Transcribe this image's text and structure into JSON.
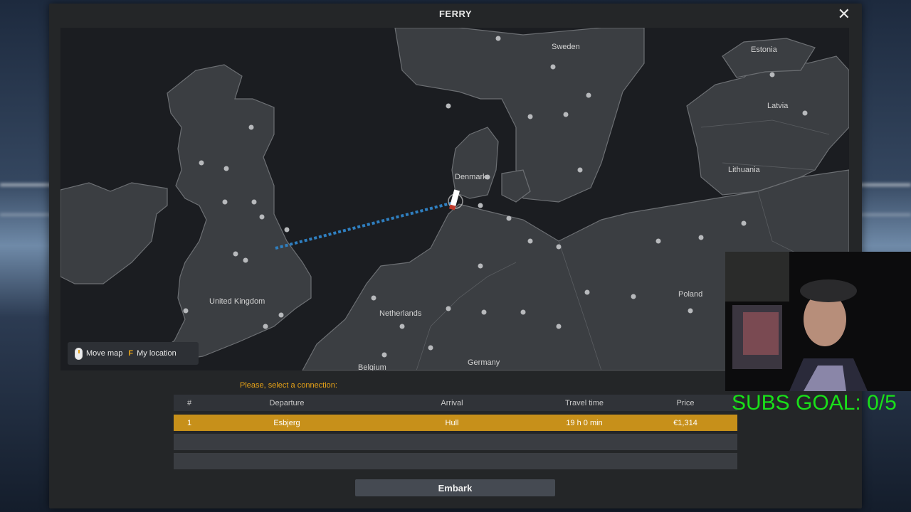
{
  "dialog": {
    "title": "FERRY",
    "close_icon": "close-icon"
  },
  "map": {
    "labels": {
      "sweden": "Sweden",
      "estonia": "Estonia",
      "latvia": "Latvia",
      "lithuania": "Lithuania",
      "denmark": "Denmark",
      "united_kingdom": "United Kingdom",
      "netherlands": "Netherlands",
      "poland": "Poland",
      "germany": "Germany",
      "belgium": "Belgium"
    },
    "route_color": "#2f7fc0"
  },
  "legend": {
    "move_map_icon": "mouse-icon",
    "move_map": "Move map",
    "my_location_key": "F",
    "my_location": "My location"
  },
  "prompt": "Please, select a connection:",
  "table": {
    "headers": {
      "num": "#",
      "departure": "Departure",
      "arrival": "Arrival",
      "travel_time": "Travel time",
      "price": "Price"
    },
    "rows": [
      {
        "num": "1",
        "departure": "Esbjerg",
        "arrival": "Hull",
        "travel_time": "19 h 0 min",
        "price": "€1,314"
      }
    ]
  },
  "embark_label": "Embark",
  "overlay": {
    "subs_goal": "SUBS GOAL: 0/5"
  },
  "colors": {
    "accent": "#e8a317",
    "selected_row": "#c7901a",
    "subs_text": "#19e019"
  }
}
